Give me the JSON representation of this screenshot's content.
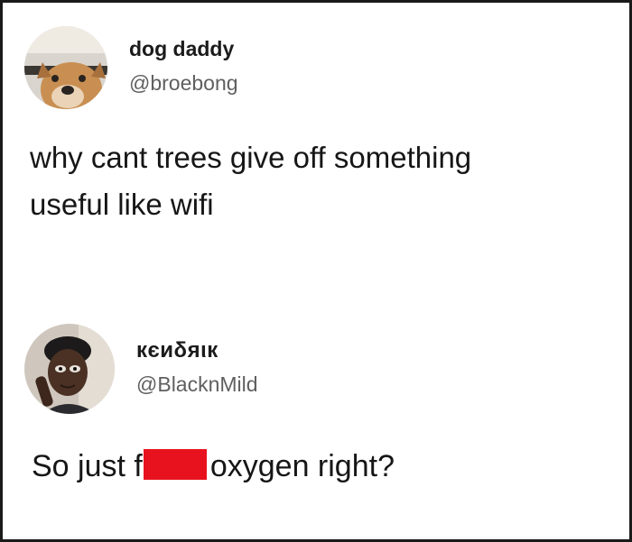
{
  "tweets": [
    {
      "display_name": "dog daddy",
      "handle": "@broebong",
      "text_lines": [
        "why cant trees give off something",
        "useful like wifi"
      ],
      "avatar_icon": "dog-avatar"
    },
    {
      "display_name": "кєиδяιк",
      "handle": "@BlacknMild",
      "text_before_censor": "So just f",
      "text_after_censor": "oxygen right?",
      "censor_color": "#e8121f",
      "avatar_icon": "person-avatar"
    }
  ]
}
